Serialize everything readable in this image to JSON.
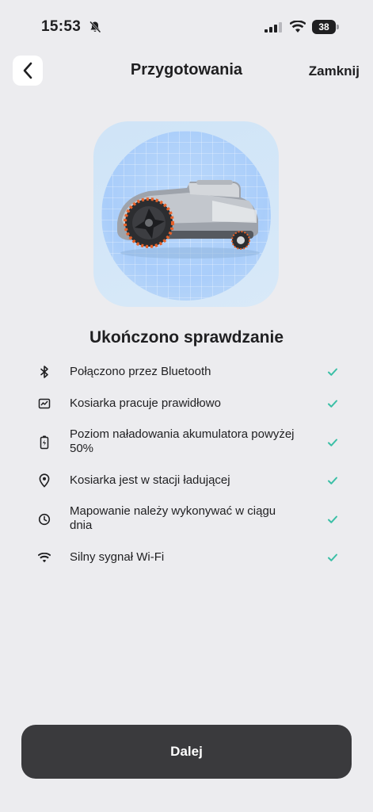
{
  "status_bar": {
    "time": "15:53",
    "battery": "38"
  },
  "header": {
    "title": "Przygotowania",
    "close_label": "Zamknij"
  },
  "section_title": "Ukończono sprawdzanie",
  "checks": [
    {
      "icon": "bluetooth-icon",
      "label": "Połączono przez Bluetooth",
      "status": "ok"
    },
    {
      "icon": "mower-status-icon",
      "label": "Kosiarka pracuje prawidłowo",
      "status": "ok"
    },
    {
      "icon": "battery-charge-icon",
      "label": "Poziom naładowania akumulatora powyżej 50%",
      "status": "ok"
    },
    {
      "icon": "location-pin-icon",
      "label": "Kosiarka jest w stacji ładującej",
      "status": "ok"
    },
    {
      "icon": "clock-icon",
      "label": "Mapowanie należy wykonywać w ciągu dnia",
      "status": "ok"
    },
    {
      "icon": "wifi-icon",
      "label": "Silny sygnał Wi-Fi",
      "status": "ok"
    }
  ],
  "next_button": {
    "label": "Dalej"
  },
  "colors": {
    "check": "#3bbfa6",
    "button": "#3a3a3d",
    "background": "#ececef"
  }
}
